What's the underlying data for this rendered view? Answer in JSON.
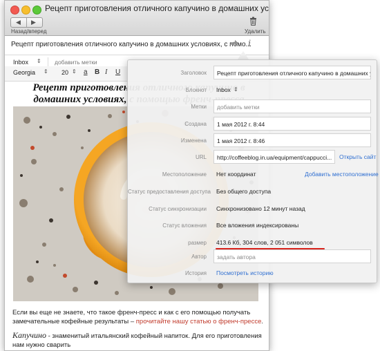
{
  "window": {
    "title": "Рецепт приготовления отличного капучино в домашних условиях, с помощью ф...",
    "nav_label": "Назад/вперед",
    "delete_label": "Удалить",
    "back_glyph": "◀",
    "forward_glyph": "▶",
    "icons": [
      "back-icon",
      "forward-icon",
      "trash-icon",
      "share-icon",
      "info-icon"
    ]
  },
  "note": {
    "title": "Рецепт приготовления отличного капучино в домашних условиях, с помо...",
    "notebook": "Inbox",
    "tags_placeholder": "добавить метки",
    "font": "Georgia",
    "font_size": "20",
    "format_buttons": [
      "a",
      "B",
      "I",
      "U"
    ],
    "heading": "Рецепт приготовления отличного капучино в домашних условиях, с помощью френч-пресса",
    "p1_text": "Если вы еще не знаете, что такое френч-пресс и как с его помощью получать  замечательные кофейные результаты – ",
    "p1_link": "прочитайте нашу статью о френч-прессе",
    "p1_end": ".",
    "p2_em": "Капучино",
    "p2_text": " - знаменитый итальянский кофейный напиток. Для его приготовления нам нужно сварить"
  },
  "info": {
    "title_label": "Заголовок",
    "title_value": "Рецепт приготовления отличного капучино в домашних у...",
    "notebook_label": "Блокнот",
    "notebook_value": "Inbox",
    "tags_label": "Метки",
    "tags_placeholder": "добавить метки",
    "created_label": "Создана",
    "created_value": "1 мая 2012 г. 8:44",
    "modified_label": "Изменена",
    "modified_value": "1 мая 2012 г. 8:46",
    "url_label": "URL",
    "url_value": "http://coffeeblog.in.ua/equipment/cappucci...",
    "open_site": "Открыть сайт",
    "location_label": "Местоположение",
    "location_value": "Нет координат",
    "add_location": "Добавить местоположение",
    "sharing_label": "Статус предоставления доступа",
    "sharing_value": "Без общего доступа",
    "sync_label": "Статус синхронизации",
    "sync_value": "Синхронизовано 12 минут назад",
    "attach_label": "Статус вложения",
    "attach_value": "Все вложения индексированы",
    "size_label": "размер",
    "size_value": "413.6 Кб, 304 слов, 2 051  символов",
    "author_label": "Автор",
    "author_placeholder": "задать автора",
    "history_label": "История",
    "history_link": "Посмотреть историю"
  },
  "colors": {
    "link": "#2f6fd1",
    "article_link": "#c03a2b",
    "underline": "#d9231c"
  }
}
